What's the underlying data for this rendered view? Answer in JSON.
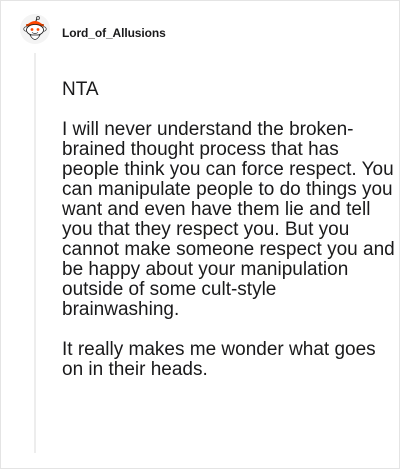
{
  "comment": {
    "author": "Lord_of_Allusions",
    "avatar_icon": "reddit-snoo-avatar-icon",
    "paragraphs": [
      "NTA",
      "I will never understand the broken-brained thought process that has people think you can force respect. You can manipulate people to do things you want and even have them lie and tell you that they respect you. But you cannot make someone respect you and be happy about your manipulation outside of some cult-style brainwashing.",
      "It really makes me wonder what goes on in their heads."
    ]
  }
}
